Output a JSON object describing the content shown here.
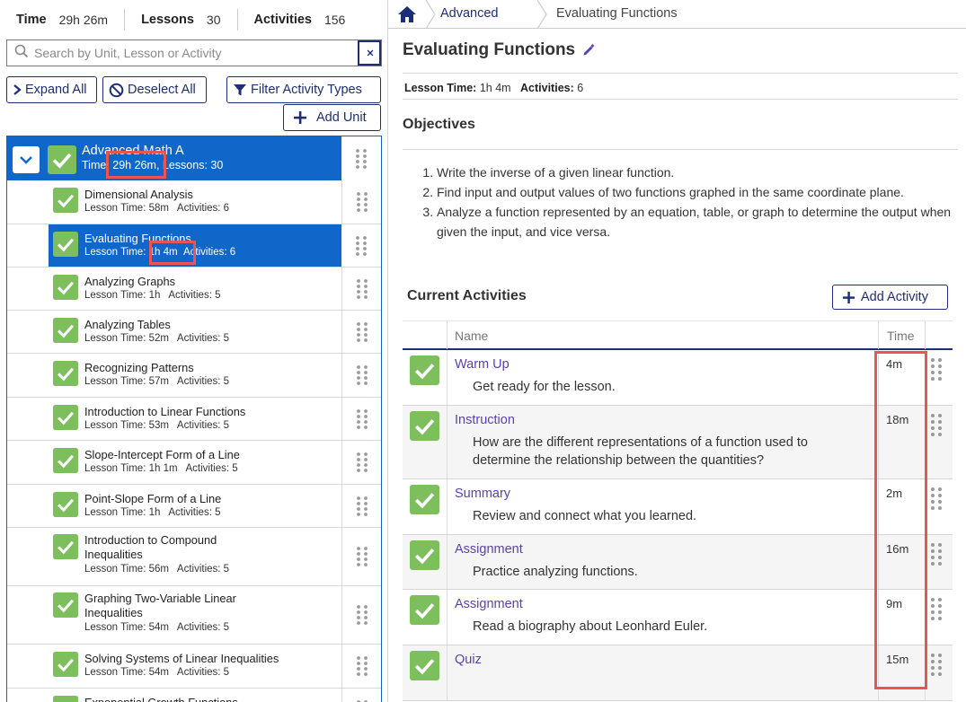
{
  "stats": {
    "time_label": "Time",
    "time_value": "29h 26m",
    "lessons_label": "Lessons",
    "lessons_value": "30",
    "activities_label": "Activities",
    "activities_value": "156"
  },
  "search": {
    "placeholder": "Search by Unit, Lesson or Activity",
    "value": ""
  },
  "toolbar": {
    "expand_all": "Expand All",
    "deselect_all": "Deselect All",
    "filter": "Filter Activity Types",
    "add_unit": "Add Unit"
  },
  "unit": {
    "name": "Advanced Math A",
    "time_prefix": "Time:",
    "time": "29h 26m",
    "lessons": ", Lessons: 30"
  },
  "lessons": [
    {
      "title": "Dimensional Analysis",
      "meta": "Lesson Time: 58m   Activities: 6"
    },
    {
      "title": "Evaluating Functions",
      "meta_prefix": "Lesson Time:",
      "time": "1h 4m",
      "meta_suffix": "Activities: 6"
    },
    {
      "title": "Analyzing Graphs",
      "meta": "Lesson Time: 1h   Activities: 5"
    },
    {
      "title": "Analyzing Tables",
      "meta": "Lesson Time: 52m   Activities: 5"
    },
    {
      "title": "Recognizing Patterns",
      "meta": "Lesson Time: 57m   Activities: 5"
    },
    {
      "title": "Introduction to Linear Functions",
      "meta": "Lesson Time: 53m   Activities: 5"
    },
    {
      "title": "Slope-Intercept Form of a Line",
      "meta": "Lesson Time: 1h 1m   Activities: 5"
    },
    {
      "title": "Point-Slope Form of a Line",
      "meta": "Lesson Time: 1h   Activities: 5"
    },
    {
      "title": "Introduction to Compound",
      "title2": "Inequalities",
      "meta": "Lesson Time: 56m   Activities: 5"
    },
    {
      "title": "Graphing Two-Variable Linear",
      "title2": "Inequalities",
      "meta": "Lesson Time: 54m   Activities: 5"
    },
    {
      "title": "Solving Systems of Linear Inequalities",
      "meta": "Lesson Time: 54m   Activities: 5"
    },
    {
      "title": "Exponential Growth Functions"
    }
  ],
  "breadcrumb": {
    "parent": "Advanced",
    "current": "Evaluating Functions"
  },
  "lesson_detail": {
    "title": "Evaluating Functions",
    "time_label": "Lesson Time:",
    "time_value": "1h 4m",
    "activities_label": "Activities:",
    "activities_value": "6",
    "objectives_heading": "Objectives",
    "objectives": [
      "Write the inverse of a given linear function.",
      "Find input and output values of two functions graphed in the same coordinate plane.",
      "Analyze a function represented by an equation, table, or graph to determine the output when given the input, and vice versa."
    ],
    "activities_heading": "Current Activities",
    "add_activity": "Add Activity",
    "col_name": "Name",
    "col_time": "Time",
    "activities": [
      {
        "name": "Warm Up",
        "desc": "Get ready for the lesson.",
        "time": "4m"
      },
      {
        "name": "Instruction",
        "desc": "How are the different representations of a function used to determine the relationship between the quantities?",
        "time": "18m"
      },
      {
        "name": "Summary",
        "desc": "Review and connect what you learned.",
        "time": "2m"
      },
      {
        "name": "Assignment",
        "desc": "Practice analyzing functions.",
        "time": "16m"
      },
      {
        "name": "Assignment",
        "desc": "Read a biography about Leonhard Euler.",
        "time": "9m"
      },
      {
        "name": "Quiz",
        "desc": "",
        "time": "15m"
      }
    ]
  },
  "colors": {
    "navy": "#1e2d78",
    "selected_blue": "#1167c9",
    "check_green": "#7cbf5c",
    "activity_link": "#5b3fb3",
    "highlight": "#e8574e"
  }
}
